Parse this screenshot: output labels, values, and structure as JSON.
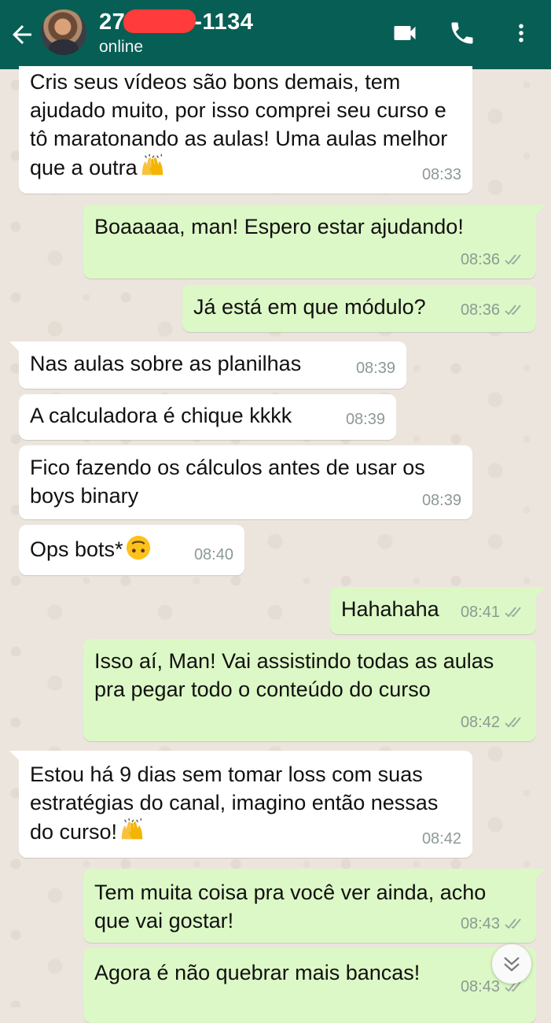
{
  "header": {
    "name_prefix": "27",
    "name_suffix": "-1134",
    "status": "online",
    "back_icon": "arrow-left-icon",
    "video_icon": "video-camera-icon",
    "phone_icon": "phone-icon",
    "menu_icon": "more-vertical-icon",
    "bar_color": "#075e54"
  },
  "colors": {
    "incoming_bubble": "#ffffff",
    "outgoing_bubble": "#dcf8c6",
    "wallpaper": "#ece5dd"
  },
  "messages": [
    {
      "direction": "in",
      "text": "Cris seus vídeos são bons demais, tem ajudado muito, por isso comprei seu curso e tô maratonando as aulas! Uma aulas melhor que a outra",
      "emoji": "raising-hands",
      "time": "08:33"
    },
    {
      "direction": "out",
      "text": "Boaaaaa, man! Espero estar ajudando!",
      "time": "08:36",
      "read": true
    },
    {
      "direction": "out",
      "text": "Já está em que módulo?",
      "time": "08:36",
      "read": true
    },
    {
      "direction": "in",
      "text": "Nas aulas sobre as planilhas",
      "time": "08:39"
    },
    {
      "direction": "in",
      "text": "A calculadora é chique kkkk",
      "time": "08:39"
    },
    {
      "direction": "in",
      "text": "Fico fazendo os cálculos antes de usar os boys binary",
      "time": "08:39"
    },
    {
      "direction": "in",
      "text": "Ops bots*",
      "emoji": "upside-down-face",
      "time": "08:40"
    },
    {
      "direction": "out",
      "text": "Hahahaha",
      "time": "08:41",
      "read": true
    },
    {
      "direction": "out",
      "text": "Isso aí, Man! Vai assistindo todas as aulas pra pegar todo o conteúdo do curso",
      "time": "08:42",
      "read": true
    },
    {
      "direction": "in",
      "text": "Estou há 9 dias sem tomar loss com suas estratégias do canal, imagino então nessas do curso!",
      "emoji": "raising-hands",
      "time": "08:42"
    },
    {
      "direction": "out",
      "text": "Tem muita coisa pra você ver ainda, acho que vai gostar!",
      "time": "08:43",
      "read": true
    },
    {
      "direction": "out",
      "text": "Agora é não quebrar mais bancas!",
      "time": "08:43",
      "read": true
    }
  ],
  "scroll_button_icon": "chevrons-down-icon"
}
